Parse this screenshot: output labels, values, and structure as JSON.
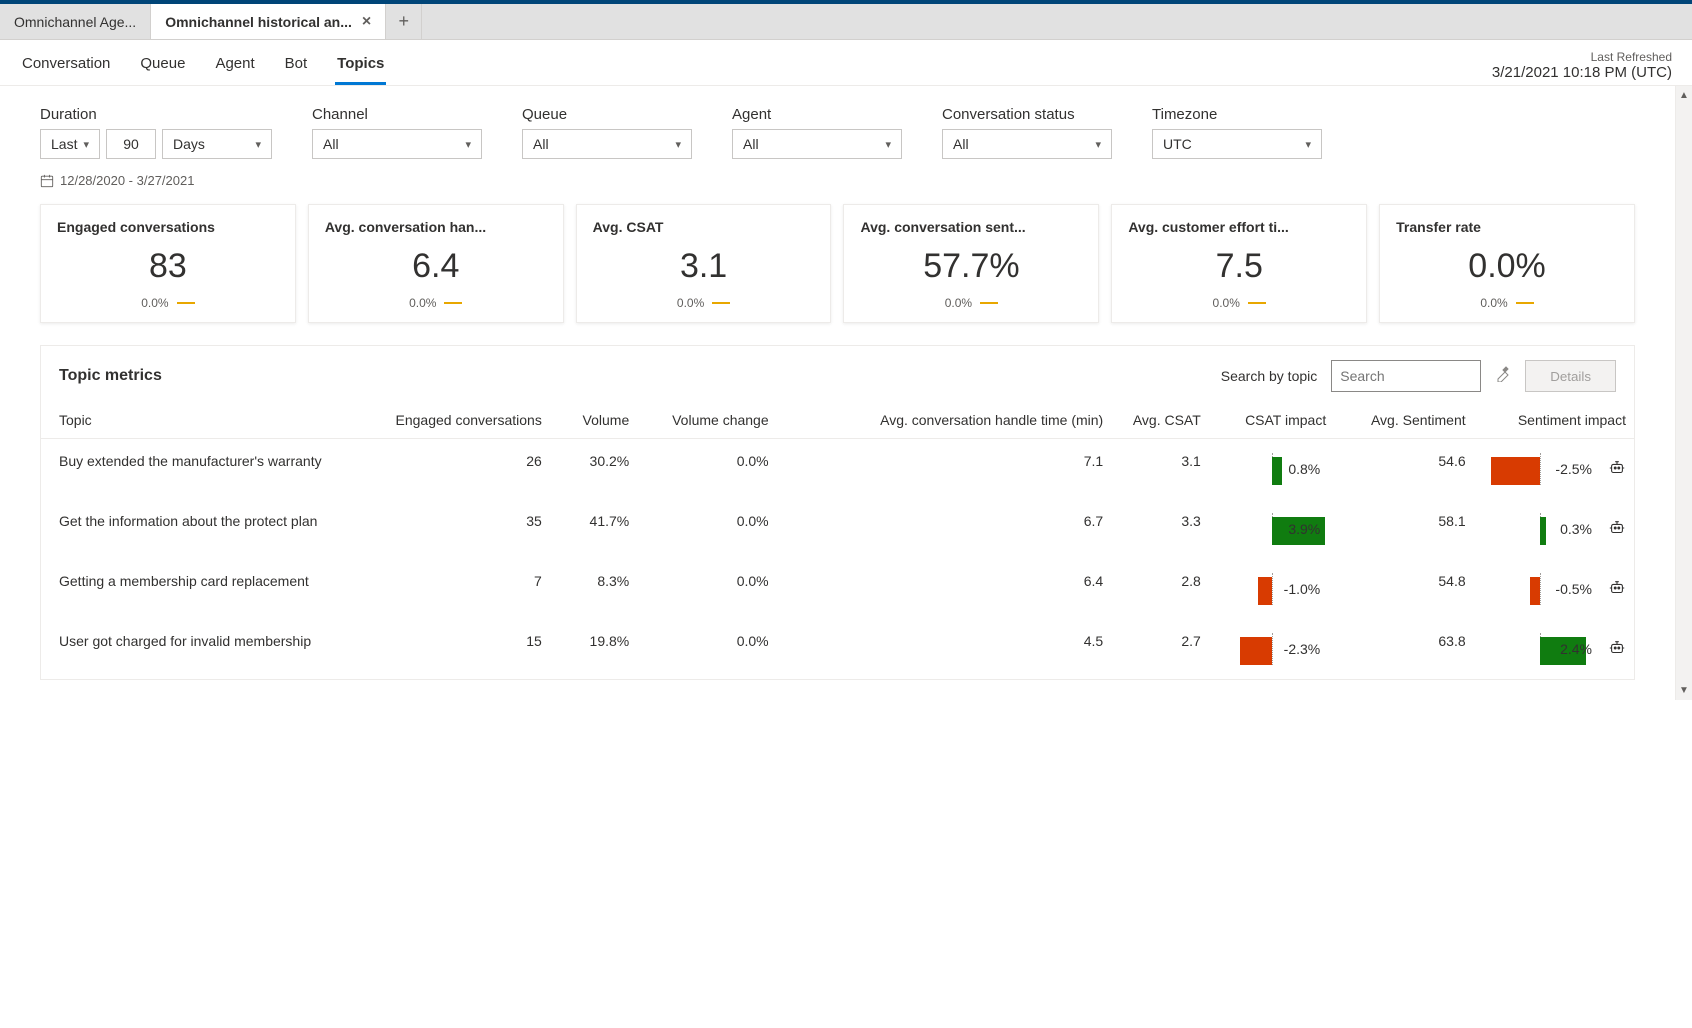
{
  "tabs": {
    "items": [
      {
        "label": "Omnichannel Age..."
      },
      {
        "label": "Omnichannel historical an..."
      }
    ],
    "active_index": 1
  },
  "nav": {
    "items": [
      "Conversation",
      "Queue",
      "Agent",
      "Bot",
      "Topics"
    ],
    "active_index": 4
  },
  "refreshed": {
    "label": "Last Refreshed",
    "value": "3/21/2021 10:18 PM (UTC)"
  },
  "filters": {
    "duration": {
      "label": "Duration",
      "mode": "Last",
      "value": "90",
      "unit": "Days",
      "range": "12/28/2020 - 3/27/2021"
    },
    "channel": {
      "label": "Channel",
      "value": "All"
    },
    "queue": {
      "label": "Queue",
      "value": "All"
    },
    "agent": {
      "label": "Agent",
      "value": "All"
    },
    "status": {
      "label": "Conversation status",
      "value": "All"
    },
    "timezone": {
      "label": "Timezone",
      "value": "UTC"
    }
  },
  "cards": [
    {
      "title": "Engaged conversations",
      "value": "83",
      "delta": "0.0%"
    },
    {
      "title": "Avg. conversation han...",
      "value": "6.4",
      "delta": "0.0%"
    },
    {
      "title": "Avg. CSAT",
      "value": "3.1",
      "delta": "0.0%"
    },
    {
      "title": "Avg. conversation sent...",
      "value": "57.7%",
      "delta": "0.0%"
    },
    {
      "title": "Avg. customer effort ti...",
      "value": "7.5",
      "delta": "0.0%"
    },
    {
      "title": "Transfer rate",
      "value": "0.0%",
      "delta": "0.0%"
    }
  ],
  "topic_metrics": {
    "title": "Topic metrics",
    "search_label": "Search by topic",
    "search_placeholder": "Search",
    "details_label": "Details",
    "columns": [
      "Topic",
      "Engaged conversations",
      "Volume",
      "Volume change",
      "Avg. conversation handle time (min)",
      "Avg. CSAT",
      "CSAT impact",
      "Avg. Sentiment",
      "Sentiment impact"
    ],
    "rows": [
      {
        "topic": "Buy extended the manufacturer's warranty",
        "engaged": "26",
        "volume": "30.2%",
        "volchange": "0.0%",
        "handle": "7.1",
        "csat": "3.1",
        "csat_impact": "0.8%",
        "csat_impact_num": 0.8,
        "sentiment": "54.6",
        "sent_impact": "-2.5%",
        "sent_impact_num": -2.5
      },
      {
        "topic": "Get the information about the protect plan",
        "engaged": "35",
        "volume": "41.7%",
        "volchange": "0.0%",
        "handle": "6.7",
        "csat": "3.3",
        "csat_impact": "3.9%",
        "csat_impact_num": 3.9,
        "sentiment": "58.1",
        "sent_impact": "0.3%",
        "sent_impact_num": 0.3
      },
      {
        "topic": "Getting a membership card replacement",
        "engaged": "7",
        "volume": "8.3%",
        "volchange": "0.0%",
        "handle": "6.4",
        "csat": "2.8",
        "csat_impact": "-1.0%",
        "csat_impact_num": -1.0,
        "sentiment": "54.8",
        "sent_impact": "-0.5%",
        "sent_impact_num": -0.5
      },
      {
        "topic": "User got charged for invalid membership",
        "engaged": "15",
        "volume": "19.8%",
        "volchange": "0.0%",
        "handle": "4.5",
        "csat": "2.7",
        "csat_impact": "-2.3%",
        "csat_impact_num": -2.3,
        "sentiment": "63.8",
        "sent_impact": "2.4%",
        "sent_impact_num": 2.4
      }
    ]
  }
}
